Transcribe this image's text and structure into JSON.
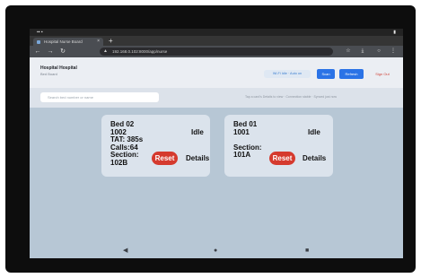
{
  "tabs": [
    {
      "label": "Hospital Nurse Board"
    }
  ],
  "address": {
    "url": "192.168.0.102:8000/app/nurse"
  },
  "header": {
    "title": "Hospital Hospital",
    "subtitle": "Bed Board",
    "net_status": "Wi-Fi Idle · Auto on",
    "scan_label": "Scan",
    "refresh_label": "Refresh",
    "logout_label": "Sign Out"
  },
  "toolbar": {
    "search_placeholder": "Search bed number or name",
    "connection_text": "Tap a card's Details to view · Connection stable · Synced just now"
  },
  "beds": [
    {
      "title": "Bed 02",
      "id": "1002",
      "lines": [
        "TAT: 385s",
        "Calls:64",
        "Section:",
        "102B"
      ],
      "status": "Idle",
      "reset_label": "Reset",
      "details_label": "Details"
    },
    {
      "title": "Bed 01",
      "id": "1001",
      "lines": [
        "",
        "Section:",
        "101A"
      ],
      "status": "Idle",
      "reset_label": "Reset",
      "details_label": "Details"
    }
  ],
  "icons": {
    "back": "←",
    "forward": "→",
    "reload": "↻",
    "lock": "▲",
    "star": "☆",
    "download": "⤓",
    "profile": "○",
    "menu": "⋮",
    "nav_back": "◀",
    "nav_home": "●",
    "nav_recent": "■",
    "new_tab": "+",
    "close": "×"
  }
}
